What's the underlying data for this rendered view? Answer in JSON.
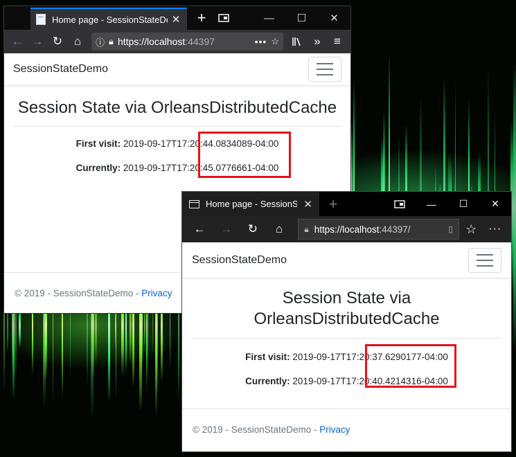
{
  "firefox": {
    "tab_title": "Home page - SessionStateDemo",
    "url_host": "https://localhost",
    "url_rest": ":44397",
    "page": {
      "brand": "SessionStateDemo",
      "heading": "Session State via OrleansDistributedCache",
      "first_visit_label": "First visit:",
      "first_visit_value": "2019-09-17T17:20:44.0834089-04:00",
      "currently_label": "Currently:",
      "currently_value": "2019-09-17T17:20:45.0776661-04:00",
      "footer_text": "© 2019 - SessionStateDemo - ",
      "footer_link": "Privacy"
    }
  },
  "edge": {
    "tab_title": "Home page - SessionStateDemo",
    "url_host": "https://localhost",
    "url_rest": ":44397/",
    "page": {
      "brand": "SessionStateDemo",
      "heading_line1": "Session State via",
      "heading_line2": "OrleansDistributedCache",
      "first_visit_label": "First visit:",
      "first_visit_value": "2019-09-17T17:20:37.6290177-04:00",
      "currently_label": "Currently:",
      "currently_value": "2019-09-17T17:20:40.4214316-04:00",
      "footer_text": "© 2019 - SessionStateDemo - ",
      "footer_link": "Privacy"
    }
  },
  "colors": {
    "highlight_box": "#e8101a",
    "link": "#0366d6",
    "firefox_accent": "#0a84ff"
  }
}
